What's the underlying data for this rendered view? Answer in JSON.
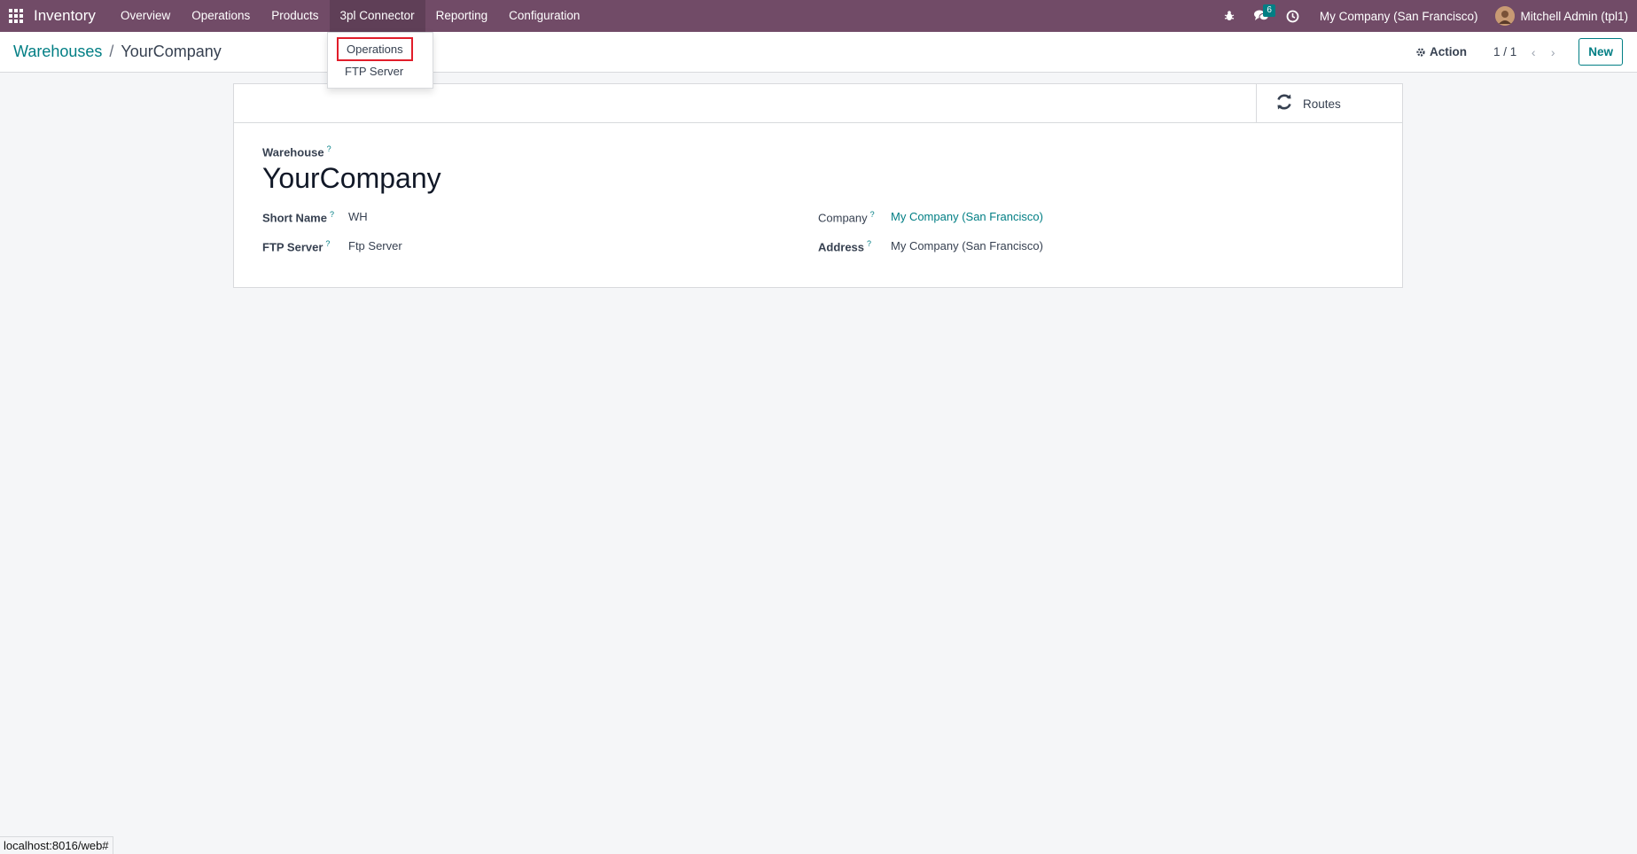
{
  "navbar": {
    "app_name": "Inventory",
    "menu": [
      {
        "label": "Overview"
      },
      {
        "label": "Operations"
      },
      {
        "label": "Products"
      },
      {
        "label": "3pl Connector"
      },
      {
        "label": "Reporting"
      },
      {
        "label": "Configuration"
      }
    ],
    "messages_badge": "6",
    "company": "My Company (San Francisco)",
    "user": "Mitchell Admin (tpl1)",
    "colors": {
      "bar": "#714b67",
      "accent": "#017e84"
    }
  },
  "dropdown": {
    "items": [
      {
        "label": "Operations"
      },
      {
        "label": "FTP Server"
      }
    ]
  },
  "breadcrumb": {
    "parent": "Warehouses",
    "separator": "/",
    "current": "YourCompany"
  },
  "control": {
    "action_label": "Action",
    "pager": "1 / 1",
    "new_label": "New"
  },
  "sheet": {
    "routes_label": "Routes",
    "warehouse_label": "Warehouse",
    "help_mark": "?",
    "warehouse_name": "YourCompany",
    "left_fields": [
      {
        "label": "Short Name",
        "value": "WH"
      },
      {
        "label": "FTP Server",
        "value": "Ftp Server"
      }
    ],
    "right_fields": [
      {
        "label": "Company",
        "value": "My Company (San Francisco)"
      },
      {
        "label": "Address",
        "value": "My Company (San Francisco)"
      }
    ]
  },
  "status_url": "localhost:8016/web#"
}
